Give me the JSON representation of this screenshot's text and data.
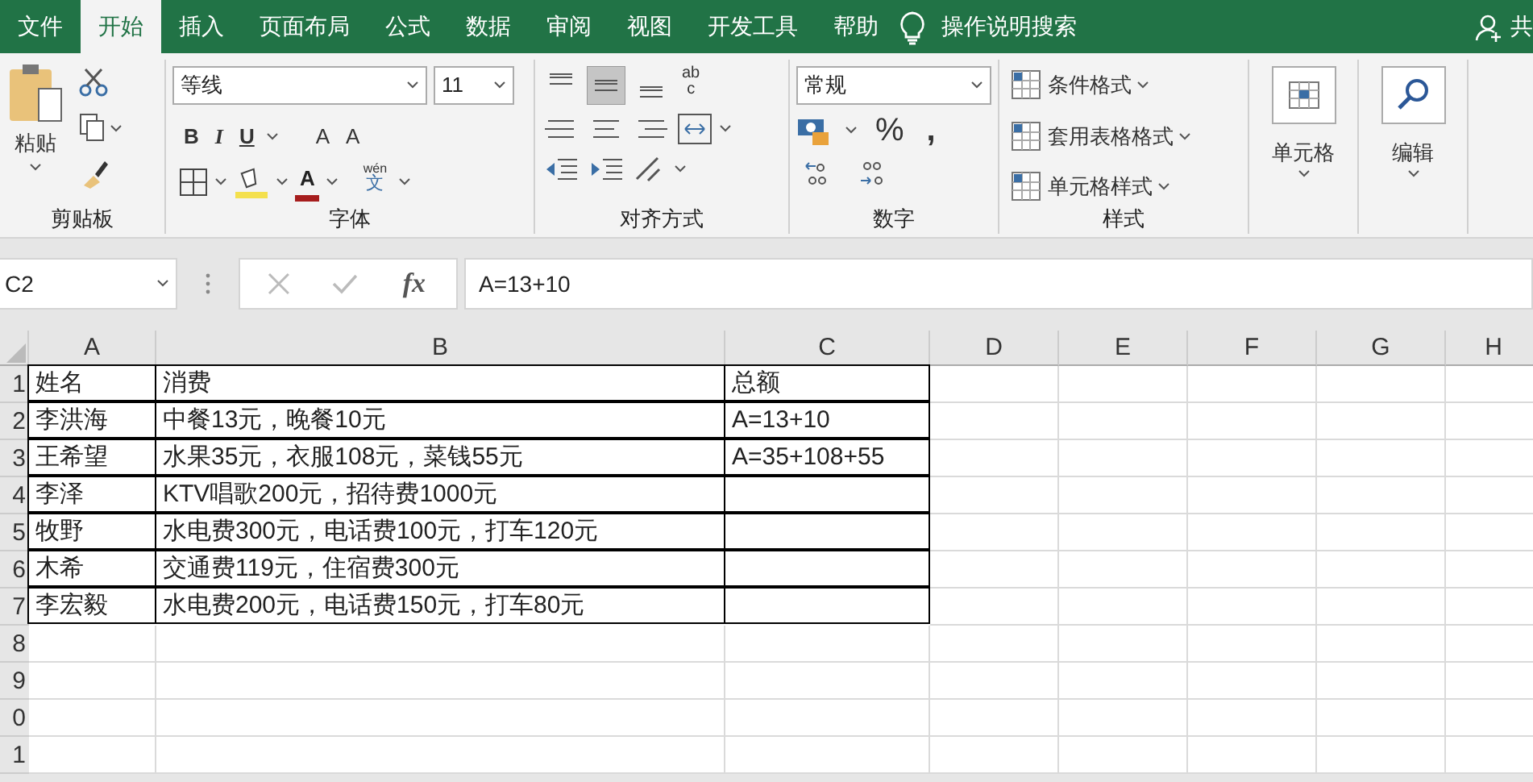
{
  "tabs": [
    {
      "label": "文件",
      "selected": false
    },
    {
      "label": "开始",
      "selected": true
    },
    {
      "label": "插入",
      "selected": false
    },
    {
      "label": "页面布局",
      "selected": false
    },
    {
      "label": "公式",
      "selected": false
    },
    {
      "label": "数据",
      "selected": false
    },
    {
      "label": "审阅",
      "selected": false
    },
    {
      "label": "视图",
      "selected": false
    },
    {
      "label": "开发工具",
      "selected": false
    },
    {
      "label": "帮助",
      "selected": false
    }
  ],
  "tell_me": "操作说明搜索",
  "share": "共",
  "ribbon": {
    "paste": "粘贴",
    "clipboard_title": "剪贴板",
    "font_name": "等线",
    "font_size": "11",
    "bold": "B",
    "italic": "I",
    "underline": "U",
    "grow_font": "A",
    "shrink_font": "A",
    "font_color": "A",
    "phonetic_top": "wén",
    "phonetic_bottom": "文",
    "font_title": "字体",
    "vertical_align": [
      {
        "selected": false
      },
      {
        "selected": true
      },
      {
        "selected": false
      }
    ],
    "wrap_top": "ab",
    "wrap_bottom": "c",
    "alignment_title": "对齐方式",
    "number_format": "常规",
    "percent": "%",
    "comma": ",",
    "number_title": "数字",
    "styles": [
      "条件格式",
      "套用表格格式",
      "单元格样式"
    ],
    "styles_title": "样式",
    "cells": "单元格",
    "editing": "编辑"
  },
  "formula_bar": {
    "name_box": "C2",
    "fx": "fx",
    "formula": "A=13+10"
  },
  "sheet": {
    "columns": [
      "A",
      "B",
      "C",
      "D",
      "E",
      "F",
      "G",
      "H"
    ],
    "row_headers": [
      "1",
      "2",
      "3",
      "4",
      "5",
      "6",
      "7",
      "8",
      "9",
      "0",
      "1"
    ],
    "rows": [
      [
        "姓名",
        "消费",
        "总额"
      ],
      [
        "李洪海",
        "中餐13元，晚餐10元",
        "A=13+10"
      ],
      [
        "王希望",
        "水果35元，衣服108元，菜钱55元",
        "A=35+108+55"
      ],
      [
        "李泽",
        "KTV唱歌200元，招待费1000元"
      ],
      [
        "牧野",
        "水电费300元，电话费100元，打车120元"
      ],
      [
        "木希",
        "交通费119元，住宿费300元"
      ],
      [
        "李宏毅",
        "水电费200元，电话费150元，打车80元"
      ]
    ]
  }
}
